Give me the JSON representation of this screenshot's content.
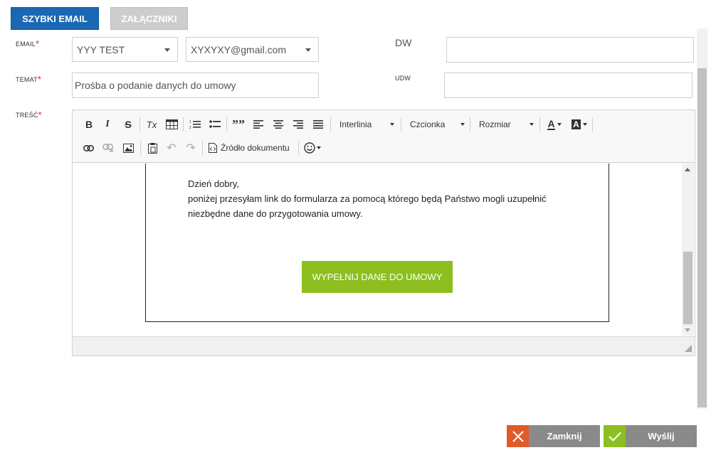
{
  "tabs": {
    "quick_email": "SZYBKI EMAIL",
    "attachments": "ZAŁĄCZNIKI"
  },
  "labels": {
    "email": "EMAIL",
    "subject": "TEMAT",
    "content": "TREŚĆ",
    "cc": "DW",
    "bcc": "UDW",
    "required": "*"
  },
  "fields": {
    "sender_select": "YYY TEST",
    "email_select": "XYXYXY@gmail.com",
    "subject": "Prośba o podanie danych do umowy",
    "cc": "",
    "bcc": ""
  },
  "toolbar": {
    "bold": "B",
    "italic": "I",
    "strike": "S",
    "clear_format": "Tx",
    "blockquote": "””",
    "line_height": "Interlinia",
    "font": "Czcionka",
    "size": "Rozmiar",
    "text_color": "A",
    "bg_color": "A",
    "source": "Źródło dokumentu"
  },
  "editor": {
    "line1": "Dzień dobry,",
    "line2": "poniżej przesyłam link do formularza za pomocą którego będą Państwo mogli uzupełnić",
    "line3": "niezbędne dane do przygotowania umowy.",
    "cta": "WYPEŁNIJ DANE DO UMOWY"
  },
  "buttons": {
    "close": "Zamknij",
    "send": "Wyślij"
  },
  "colors": {
    "primary": "#1a68b4",
    "accent_green": "#8cbf1f",
    "danger": "#e05a2b",
    "button_gray": "#8a8a8a",
    "required": "#e02828"
  }
}
